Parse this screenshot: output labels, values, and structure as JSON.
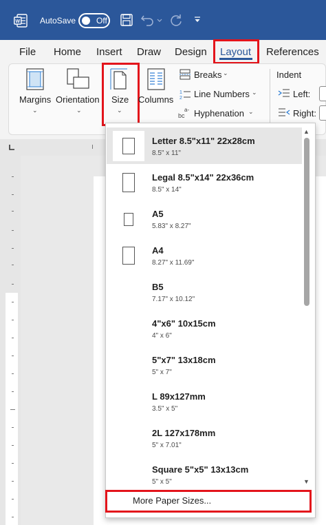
{
  "titlebar": {
    "autosave_label": "AutoSave",
    "autosave_state": "Off",
    "colors": {
      "bg": "#2b579a",
      "text": "#ffffff"
    },
    "icons": [
      "word-app-icon",
      "save-icon",
      "undo-icon",
      "redo-icon",
      "customize-qat-icon"
    ]
  },
  "tabs": [
    "File",
    "Home",
    "Insert",
    "Draw",
    "Design",
    "Layout",
    "References"
  ],
  "active_tab": "Layout",
  "ribbon": {
    "margins": "Margins",
    "orientation": "Orientation",
    "size": "Size",
    "columns": "Columns",
    "breaks": "Breaks",
    "line_numbers": "Line Numbers",
    "hyphenation": "Hyphenation",
    "indent": "Indent",
    "left": "Left:",
    "right": "Right:"
  },
  "size_menu": {
    "items": [
      {
        "name": "Letter 8.5\"x11\" 22x28cm",
        "dims": "8.5\" x 11\""
      },
      {
        "name": "Legal 8.5\"x14\" 22x36cm",
        "dims": "8.5\" x 14\""
      },
      {
        "name": "A5",
        "dims": "5.83\" x 8.27\""
      },
      {
        "name": "A4",
        "dims": "8.27\" x 11.69\""
      },
      {
        "name": "B5",
        "dims": "7.17\" x 10.12\""
      },
      {
        "name": "4\"x6\" 10x15cm",
        "dims": "4\" x 6\""
      },
      {
        "name": "5\"x7\" 13x18cm",
        "dims": "5\" x 7\""
      },
      {
        "name": "L 89x127mm",
        "dims": "3.5\" x 5\""
      },
      {
        "name": "2L 127x178mm",
        "dims": "5\" x 7.01\""
      },
      {
        "name": "Square 5\"x5\" 13x13cm",
        "dims": "5\" x 5\""
      }
    ],
    "selected_index": 0,
    "more": "More Paper Sizes..."
  },
  "highlight_color": "#e3141b"
}
